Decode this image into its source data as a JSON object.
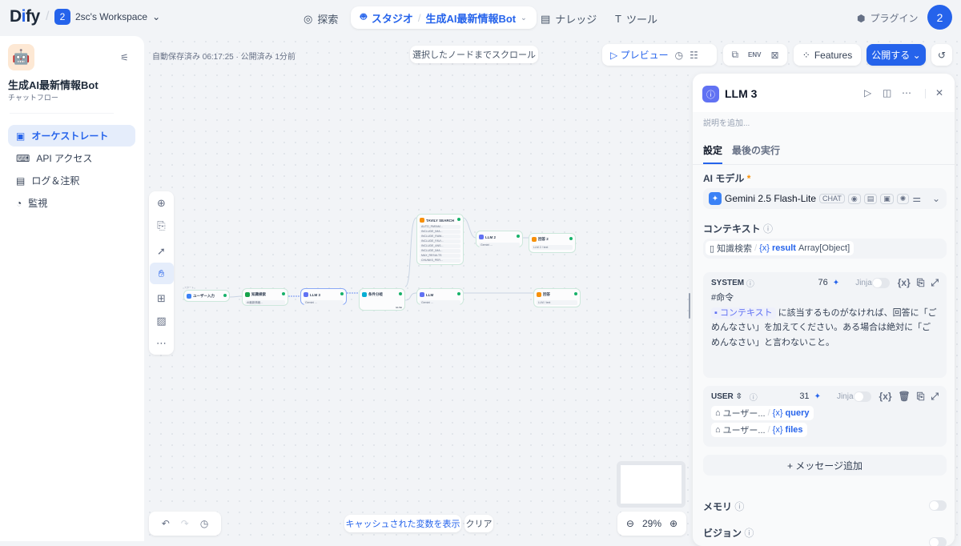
{
  "topbar": {
    "logo": "Dify",
    "workspace_badge": "2",
    "workspace_name": "2sc's Workspace",
    "nav": [
      {
        "label": "探索"
      },
      {
        "label": "スタジオ"
      },
      {
        "label": "ナレッジ"
      },
      {
        "label": "ツール"
      }
    ],
    "breadcrumb_app": "生成AI最新情報Bot",
    "plugins": "プラグイン",
    "avatar": "2"
  },
  "sidebar": {
    "app_name": "生成AI最新情報Bot",
    "app_type": "チャットフロー",
    "items": [
      {
        "label": "オーケストレート",
        "active": true
      },
      {
        "label": "API アクセス"
      },
      {
        "label": "ログ＆注釈"
      },
      {
        "label": "監視"
      }
    ]
  },
  "canvas": {
    "autosave_status": "自動保存済み 06:17:25 · 公開済み 1分前",
    "scroll_to_node": "選択したノードまでスクロール",
    "preview": "プレビュー",
    "features": "Features",
    "publish": "公開する",
    "show_cached_vars": "キャッシュされた変数を表示",
    "clear": "クリア",
    "zoom": "29%",
    "nodes": [
      {
        "title": "ユーザー入力",
        "tag": "スタート"
      },
      {
        "title": "知識検索",
        "row": "AI最新情報..."
      },
      {
        "title": "LLM 3",
        "row": "Gemini ..."
      },
      {
        "title": "条件分岐",
        "row": "ELSE"
      },
      {
        "title": "TAVILY SEARCH",
        "rows": [
          "AUTO_PARAM...",
          "INCLUDE_IMA...",
          "INCLUDE_RAW...",
          "INCLUDE_FAVI...",
          "INCLUDE_ANS...",
          "INCLUDE_IMA...",
          "MAX_RESULTS",
          "CHUNKS_PER..."
        ]
      },
      {
        "title": "LLM 2",
        "row": "Gemini ..."
      },
      {
        "title": "回答 2",
        "row": "LLM 2 / text"
      },
      {
        "title": "LLM",
        "row": "Gemini ..."
      },
      {
        "title": "回答",
        "row": "LLM / text"
      }
    ]
  },
  "panel": {
    "title": "LLM 3",
    "description_placeholder": "説明を追加...",
    "tabs": [
      {
        "label": "設定",
        "active": true
      },
      {
        "label": "最後の実行"
      }
    ],
    "model_label": "AI モデル",
    "model_name": "Gemini 2.5 Flash-Lite",
    "model_mode": "CHAT",
    "context_label": "コンテキスト",
    "context_node": "知識検索",
    "context_var": "result",
    "context_type": "Array[Object]",
    "system": {
      "role": "SYSTEM",
      "count": "76",
      "jinja": "Jinja",
      "line1": "#命令",
      "context_chip": "コンテキスト",
      "text": "に該当するものがなければ、回答に「ごめんなさい」を加えてください。ある場合は絶対に「ごめんなさい」と言わないこと。"
    },
    "user": {
      "role": "USER",
      "count": "31",
      "jinja": "Jinja",
      "vars": [
        {
          "node": "ユーザー...",
          "var": "query"
        },
        {
          "node": "ユーザー...",
          "var": "files"
        }
      ]
    },
    "add_message": "+ メッセージ追加",
    "memory": "メモリ",
    "vision": "ビジョン"
  }
}
